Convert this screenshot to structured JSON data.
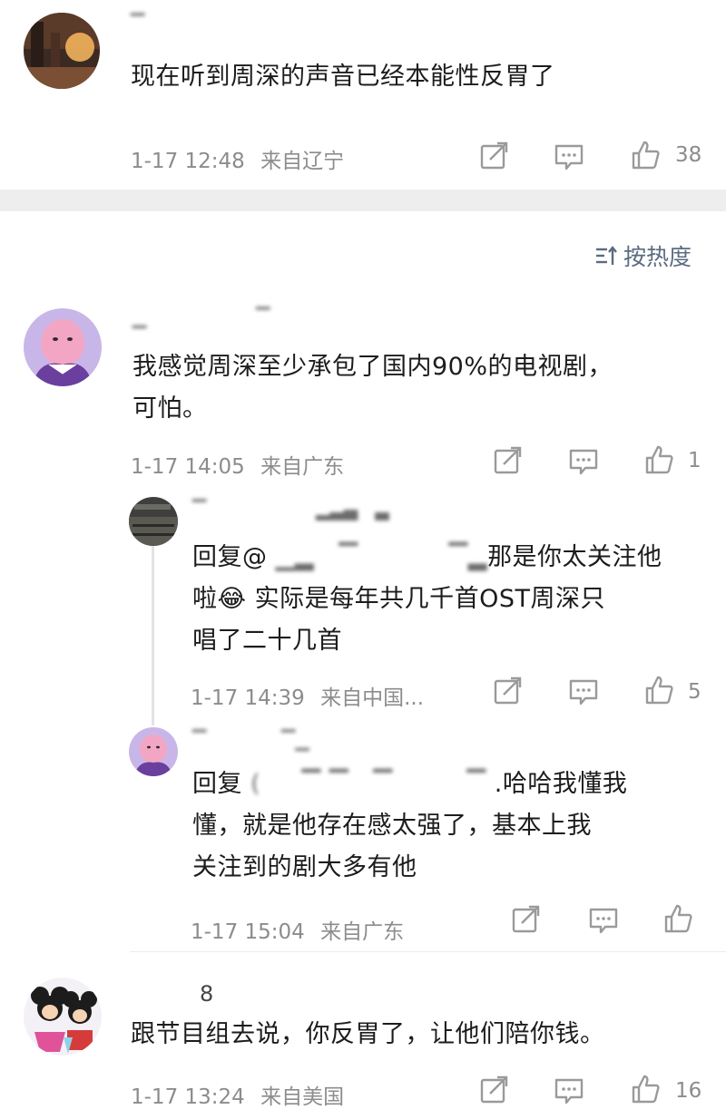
{
  "comments": [
    {
      "text": "现在听到周深的声音已经本能性反胃了",
      "time": "1-17 12:48",
      "location": "来自辽宁",
      "likes": "38"
    },
    {
      "text_line1": "我感觉周深至少承包了国内90%的电视剧，",
      "text_line2": "可怕。",
      "time": "1-17 14:05",
      "location": "来自广东",
      "likes": "1"
    },
    {
      "username": "8",
      "text": "跟节目组去说，你反胃了，让他们陪你钱。",
      "time": "1-17 13:24",
      "location": "来自美国",
      "likes": "16"
    }
  ],
  "replies": [
    {
      "prefix": "回复@",
      "line1_tail": "那是你太关注他",
      "line2": "啦😂 实际是每年共几千首OST周深只",
      "line3": "唱了二十几首",
      "time": "1-17 14:39",
      "location": "来自中国...",
      "likes": "5"
    },
    {
      "prefix": "回复",
      "line1_tail": ".哈哈我懂我",
      "line2": "懂，就是他存在感太强了，基本上我",
      "line3": "关注到的剧大多有他",
      "time": "1-17 15:04",
      "location": "来自广东",
      "likes": ""
    }
  ],
  "sort": {
    "label": "按热度",
    "icon": "sort-icon"
  },
  "icons": {
    "share": "share-icon",
    "comment": "comment-icon",
    "like": "thumbs-up-icon"
  },
  "colors": {
    "meta_text": "#8c8c8c",
    "sort_text": "#5b6b80",
    "separator": "#eeeeee"
  }
}
